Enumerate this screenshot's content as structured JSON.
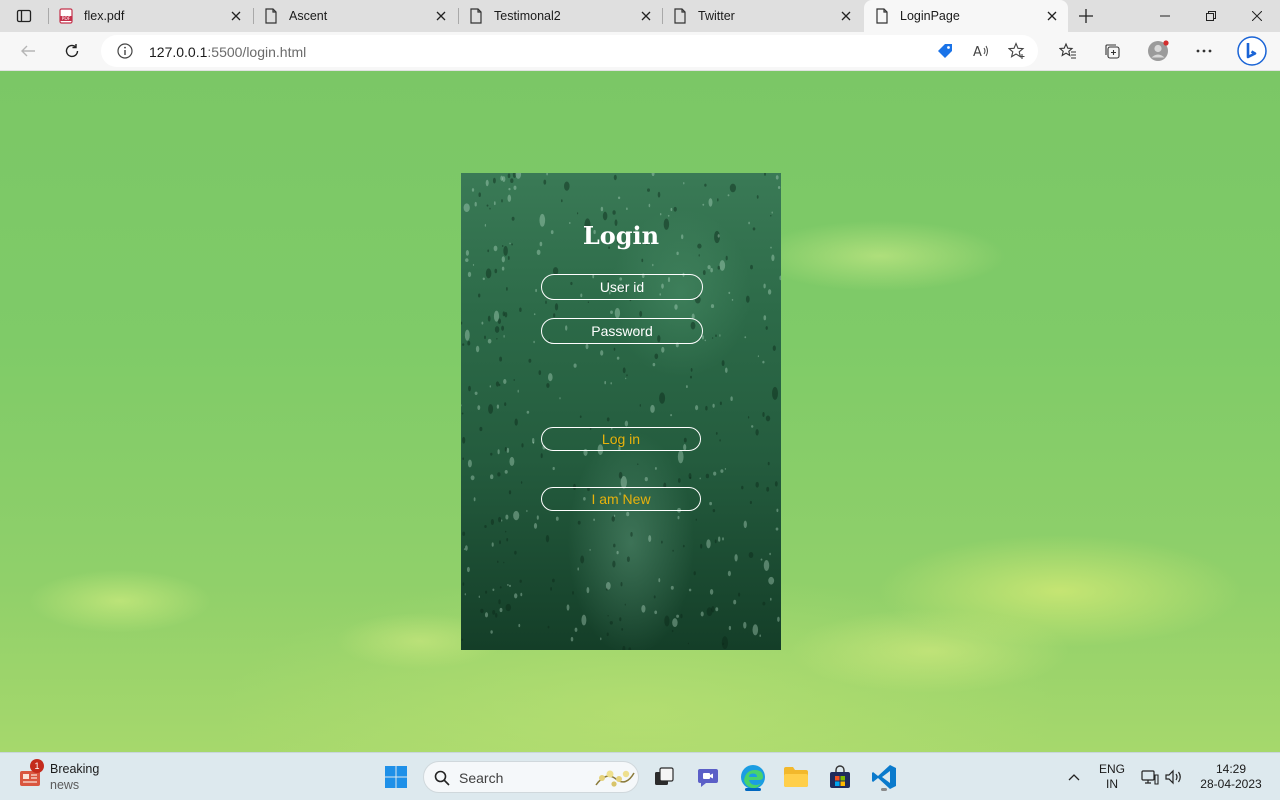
{
  "browser": {
    "tabs": [
      {
        "title": "flex.pdf",
        "icon": "pdf-icon"
      },
      {
        "title": "Ascent",
        "icon": "page-icon"
      },
      {
        "title": "Testimonal2",
        "icon": "page-icon"
      },
      {
        "title": "Twitter",
        "icon": "page-icon"
      },
      {
        "title": "LoginPage",
        "icon": "page-icon",
        "active": true
      }
    ],
    "url_host": "127.0.0.1",
    "url_rest": ":5500/login.html"
  },
  "login": {
    "heading": "Login",
    "userid_placeholder": "User id",
    "password_placeholder": "Password",
    "login_button": "Log in",
    "new_button": "I am New"
  },
  "taskbar": {
    "news_title": "Breaking",
    "news_sub": "news",
    "news_badge": "1",
    "search_label": "Search",
    "lang_1": "ENG",
    "lang_2": "IN",
    "time": "14:29",
    "date": "28-04-2023"
  },
  "colors": {
    "page_green": "#7fcb68",
    "card_green": "#245c3e",
    "button_text": "#e8b20c",
    "accent": "#0067c0"
  }
}
